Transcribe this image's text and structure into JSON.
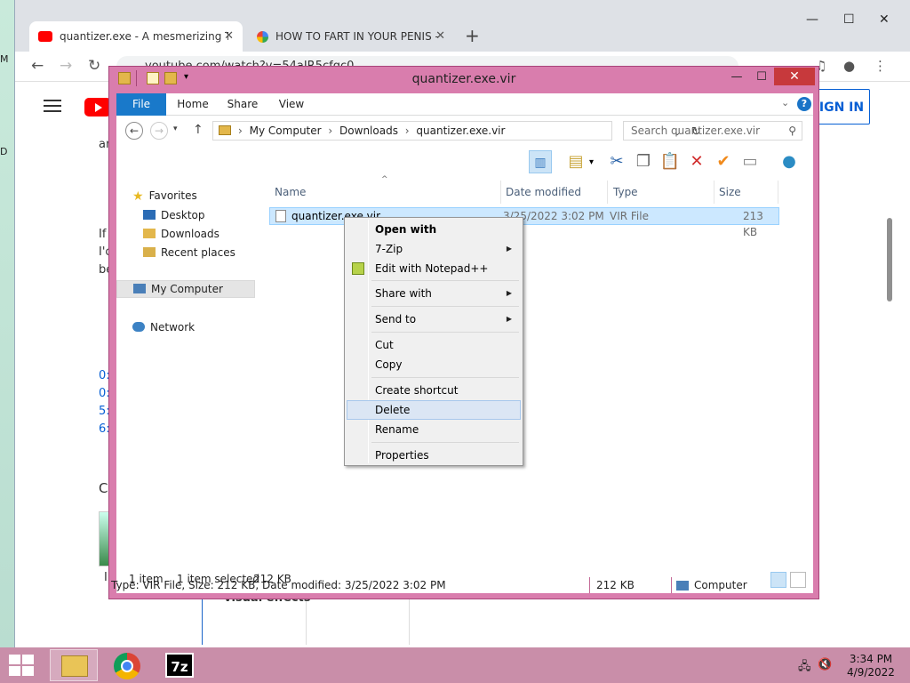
{
  "desktop": {
    "labels": [
      "M",
      "D"
    ]
  },
  "chrome": {
    "tabs": [
      {
        "title": "quantizer.exe - A mesmerizing Tr",
        "favicon": "youtube-icon"
      },
      {
        "title": "HOW TO FART IN YOUR PENIS -",
        "favicon": "google-icon"
      }
    ],
    "address": "youtube.com/watch?v=54aIR5cfgc0",
    "signin_label": "IGN IN",
    "page_fragments": {
      "line1": "an",
      "line2": "If",
      "line3": "I'c",
      "line4": "be",
      "links": [
        "0:",
        "0:",
        "5:",
        "6:"
      ],
      "section": "C",
      "thumb_caption": "I",
      "visual_effects": "visual effects"
    }
  },
  "explorer": {
    "title": "quantizer.exe.vir",
    "ribbon_tabs": [
      "File",
      "Home",
      "Share",
      "View"
    ],
    "breadcrumb": [
      "My Computer",
      "Downloads",
      "quantizer.exe.vir"
    ],
    "search_placeholder": "Search quantizer.exe.vir",
    "nav": {
      "favorites": "Favorites",
      "desktop": "Desktop",
      "downloads": "Downloads",
      "recent": "Recent places",
      "computer": "My Computer",
      "network": "Network"
    },
    "columns": [
      "Name",
      "Date modified",
      "Type",
      "Size"
    ],
    "files": [
      {
        "name": "quantizer.exe.vir",
        "date": "3/25/2022 3:02 PM",
        "type": "VIR File",
        "size": "213 KB"
      }
    ],
    "status": {
      "items": "1 item",
      "selected": "1 item selected",
      "selected_size": "212 KB"
    },
    "info": {
      "details": "Type: VIR File, Size: 212 KB, Date modified: 3/25/2022 3:02 PM",
      "size": "212 KB",
      "location": "Computer"
    }
  },
  "context_menu": {
    "items": [
      {
        "label": "Open with"
      },
      {
        "label": "7-Zip"
      },
      {
        "label": "Edit with Notepad++"
      },
      {
        "label": "Share with"
      },
      {
        "label": "Send to"
      },
      {
        "label": "Cut"
      },
      {
        "label": "Copy"
      },
      {
        "label": "Create shortcut"
      },
      {
        "label": "Delete"
      },
      {
        "label": "Rename"
      },
      {
        "label": "Properties"
      }
    ]
  },
  "taskbar": {
    "apps": [
      "file-explorer",
      "google-chrome",
      "7-zip"
    ],
    "sevenzip_label": "7z",
    "time": "3:34 PM",
    "date": "4/9/2022"
  },
  "colors": {
    "explorer_frame": "#d97dad",
    "taskbar": "#c98ea9",
    "selection": "#cce8ff",
    "file_tab": "#1979ca",
    "close_button": "#c7393c"
  }
}
